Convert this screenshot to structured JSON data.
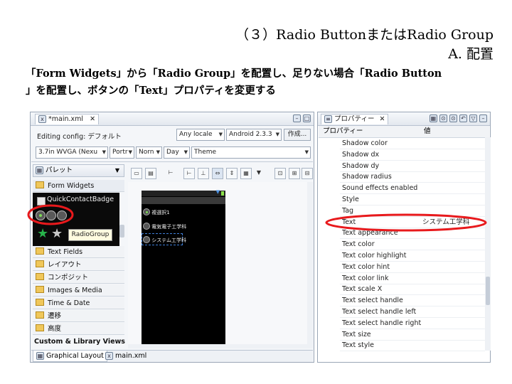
{
  "slide": {
    "title_line1": "（３）Radio ButtonまたはRadio Group",
    "title_line2": "A. 配置",
    "desc_line1": "「Form Widgets」から「Radio Group」を配置し、足りない場合「Radio Button",
    "desc_line2": "」を配置し、ボタンの「Text」プロパティを変更する"
  },
  "editor": {
    "tab_label": "*main.xml",
    "config_label": "Editing config: デフォルト",
    "locale": "Any locale",
    "target": "Android 2.3.3",
    "create_btn": "作成...",
    "device": "3.7in WVGA (Nexu",
    "orientation": "Portr",
    "dock": "Norn",
    "night": "Day",
    "theme": "Theme",
    "bottom_tabs": [
      "Graphical Layout",
      "main.xml"
    ]
  },
  "palette": {
    "header": "パレット",
    "form_widgets": "Form Widgets",
    "quick_contact": "QuickContactBadge",
    "tooltip": "RadioGroup",
    "categories": [
      "Text Fields",
      "レイアウト",
      "コンポジット",
      "Images & Media",
      "Time & Date",
      "遷移",
      "高度"
    ],
    "custom": "Custom & Library Views"
  },
  "canvas": {
    "radio_items": [
      "複選択1",
      "電気電子工学科",
      "システム工学科"
    ]
  },
  "properties": {
    "tab_label": "プロパティー",
    "col_property": "プロパティー",
    "col_value": "値",
    "rows": [
      {
        "name": "Shadow color",
        "value": ""
      },
      {
        "name": "Shadow dx",
        "value": ""
      },
      {
        "name": "Shadow dy",
        "value": ""
      },
      {
        "name": "Shadow radius",
        "value": ""
      },
      {
        "name": "Sound effects enabled",
        "value": ""
      },
      {
        "name": "Style",
        "value": ""
      },
      {
        "name": "Tag",
        "value": ""
      },
      {
        "name": "Text",
        "value": "システム工学科"
      },
      {
        "name": "Text appearance",
        "value": ""
      },
      {
        "name": "Text color",
        "value": ""
      },
      {
        "name": "Text color highlight",
        "value": ""
      },
      {
        "name": "Text color hint",
        "value": ""
      },
      {
        "name": "Text color link",
        "value": ""
      },
      {
        "name": "Text scale X",
        "value": ""
      },
      {
        "name": "Text select handle",
        "value": ""
      },
      {
        "name": "Text select handle left",
        "value": ""
      },
      {
        "name": "Text select handle right",
        "value": ""
      },
      {
        "name": "Text size",
        "value": ""
      },
      {
        "name": "Text style",
        "value": ""
      }
    ]
  },
  "colors": {
    "highlight_ellipse": "#e8191c",
    "canvas_bg": "#000000",
    "selection_blue": "#3f7fd8"
  }
}
